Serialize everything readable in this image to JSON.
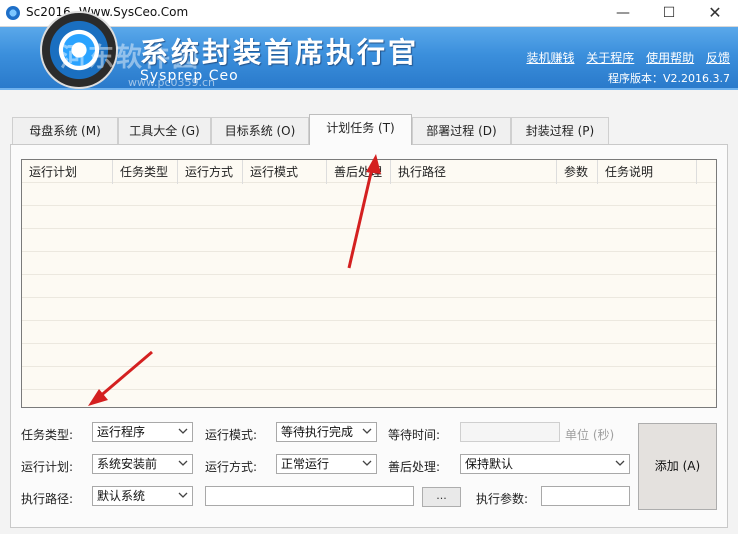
{
  "window": {
    "title": "Sc2016- Www.SysCeo.Com",
    "min": "—",
    "max": "☐",
    "close": "✕"
  },
  "header": {
    "watermark": "河东软件园",
    "watermark_url": "www.pc0359.cn",
    "product_title": "系统封装首席执行官",
    "product_subtitle": "Sysprep  Ceo",
    "links": [
      "装机赚钱",
      "关于程序",
      "使用帮助",
      "反馈"
    ],
    "version": "程序版本：V2.2016.3.7"
  },
  "tabs": [
    {
      "label": "母盘系统 (M)"
    },
    {
      "label": "工具大全 (G)"
    },
    {
      "label": "目标系统 (O)"
    },
    {
      "label": "计划任务 (T)",
      "active": true
    },
    {
      "label": "部署过程 (D)"
    },
    {
      "label": "封装过程 (P)"
    }
  ],
  "table": {
    "columns": [
      "运行计划",
      "任务类型",
      "运行方式",
      "运行模式",
      "善后处理",
      "执行路径",
      "参数",
      "任务说明"
    ],
    "rows": []
  },
  "form": {
    "task_type_label": "任务类型:",
    "task_type_value": "运行程序",
    "run_mode_label": "运行模式:",
    "run_mode_value": "等待执行完成",
    "wait_time_label": "等待时间:",
    "wait_time_value": "",
    "unit_label": "单位 (秒)",
    "run_plan_label": "运行计划:",
    "run_plan_value": "系统安装前",
    "run_method_label": "运行方式:",
    "run_method_value": "正常运行",
    "aftercare_label": "善后处理:",
    "aftercare_value": "保持默认",
    "exec_path_label": "执行路径:",
    "exec_path_value": "默认系统",
    "path_text_value": "",
    "browse_label": "...",
    "exec_params_label": "执行参数:",
    "exec_params_value": "",
    "add_button": "添加 (A)"
  },
  "colors": {
    "banner": "#3b8fdc",
    "annotation_arrow": "#d42020"
  }
}
